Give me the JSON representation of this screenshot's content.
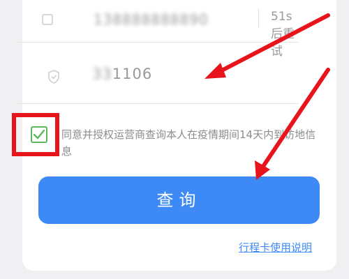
{
  "form": {
    "phone_value": "138888888890",
    "resend_label": "51s后重试",
    "code_value_prefix": "33",
    "code_value_suffix": "1106",
    "agree_checked": true,
    "agree_text": "同意并授权运营商查询本人在疫情期间14天内到访地信息"
  },
  "actions": {
    "query_label": "查询",
    "guide_link": "行程卡使用说明"
  },
  "colors": {
    "primary": "#3d8af7",
    "check": "#5cb85c",
    "annotation_red": "#e8141c"
  },
  "icons": {
    "phone": "phone-icon",
    "shield": "shield-icon",
    "check": "check-icon"
  }
}
